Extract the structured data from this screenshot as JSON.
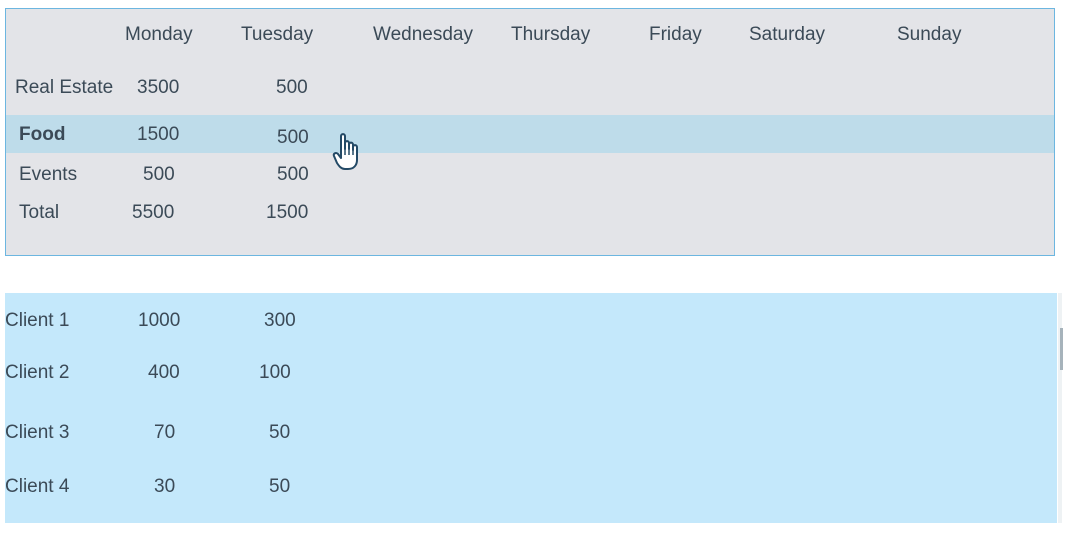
{
  "top_table": {
    "headers": [
      "Monday",
      "Tuesday",
      "Wednesday",
      "Thursday",
      "Friday",
      "Saturday",
      "Sunday"
    ],
    "rows": [
      {
        "label": "Real Estate",
        "monday": "3500",
        "tuesday": "500"
      },
      {
        "label": "Food",
        "monday": "1500",
        "tuesday": "500"
      },
      {
        "label": "Events",
        "monday": "500",
        "tuesday": "500"
      },
      {
        "label": "Total",
        "monday": "5500",
        "tuesday": "1500"
      }
    ]
  },
  "bottom_table": {
    "rows": [
      {
        "label": "Client 1",
        "monday": "1000",
        "tuesday": "300"
      },
      {
        "label": "Client 2",
        "monday": "400",
        "tuesday": "100"
      },
      {
        "label": "Client 3",
        "monday": "70",
        "tuesday": "50"
      },
      {
        "label": "Client 4",
        "monday": "30",
        "tuesday": "50"
      }
    ]
  },
  "cursor_icon": "hand-pointer-icon",
  "colors": {
    "top_panel_bg": "#e3e4e8",
    "top_panel_border": "#6cb6e0",
    "selected_row_bg": "#bedcea",
    "bottom_panel_bg": "#c4e8fb",
    "text": "#3b4a57"
  }
}
